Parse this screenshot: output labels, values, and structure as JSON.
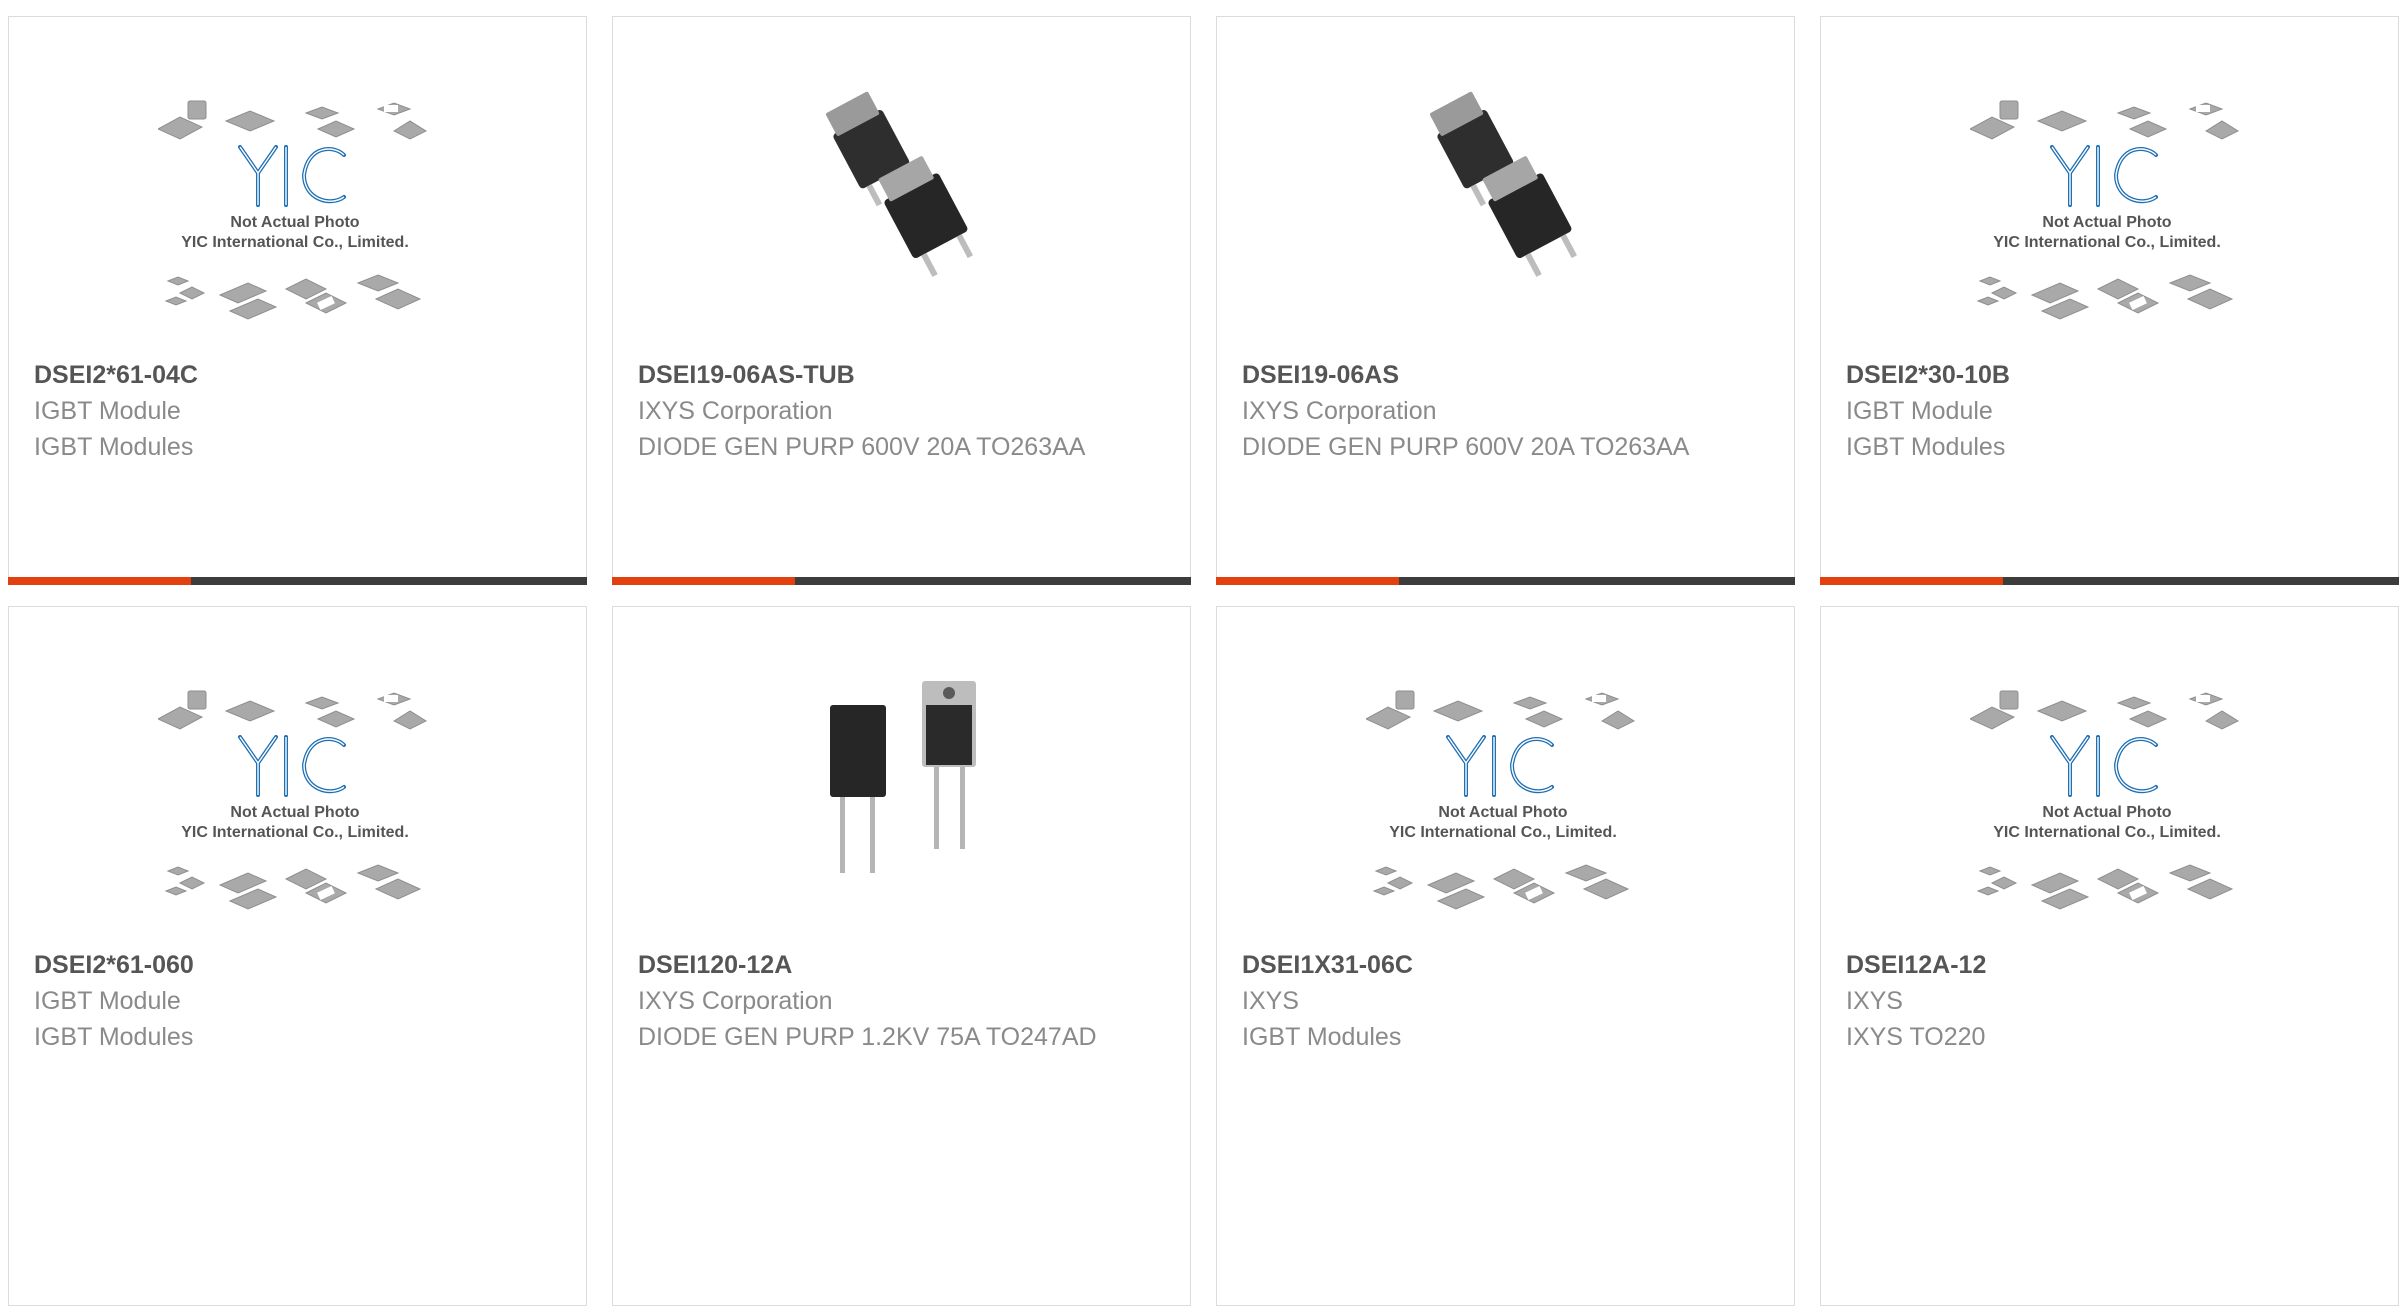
{
  "colors": {
    "accent_bar": "#e3400f",
    "dark_bar": "#3c3c3c",
    "yic_logo": "#1f6fb3",
    "part_text": "#555555",
    "desc_text": "#8a8a8a"
  },
  "placeholder": {
    "line1": "Not Actual Photo",
    "line2": "YIC International Co., Limited."
  },
  "cards": [
    {
      "part_number": "DSEI2*61-04C",
      "manufacturer": "IGBT Module",
      "description": "IGBT Modules",
      "image": "yic-placeholder-icon"
    },
    {
      "part_number": "DSEI19-06AS-TUB",
      "manufacturer": "IXYS Corporation",
      "description": "DIODE GEN PURP 600V 20A TO263AA",
      "image": "to263-package-icon"
    },
    {
      "part_number": "DSEI19-06AS",
      "manufacturer": "IXYS Corporation",
      "description": "DIODE GEN PURP 600V 20A TO263AA",
      "image": "to263-package-icon"
    },
    {
      "part_number": "DSEI2*30-10B",
      "manufacturer": "IGBT Module",
      "description": "IGBT Modules",
      "image": "yic-placeholder-icon"
    },
    {
      "part_number": "DSEI2*61-060",
      "manufacturer": "IGBT Module",
      "description": "IGBT Modules",
      "image": "yic-placeholder-icon"
    },
    {
      "part_number": "DSEI120-12A",
      "manufacturer": "IXYS Corporation",
      "description": "DIODE GEN PURP 1.2KV 75A TO247AD",
      "image": "to247-package-icon"
    },
    {
      "part_number": "DSEI1X31-06C",
      "manufacturer": "IXYS",
      "description": "IGBT Modules",
      "image": "yic-placeholder-icon"
    },
    {
      "part_number": "DSEI12A-12",
      "manufacturer": "IXYS",
      "description": "IXYS TO220",
      "image": "yic-placeholder-icon"
    }
  ]
}
